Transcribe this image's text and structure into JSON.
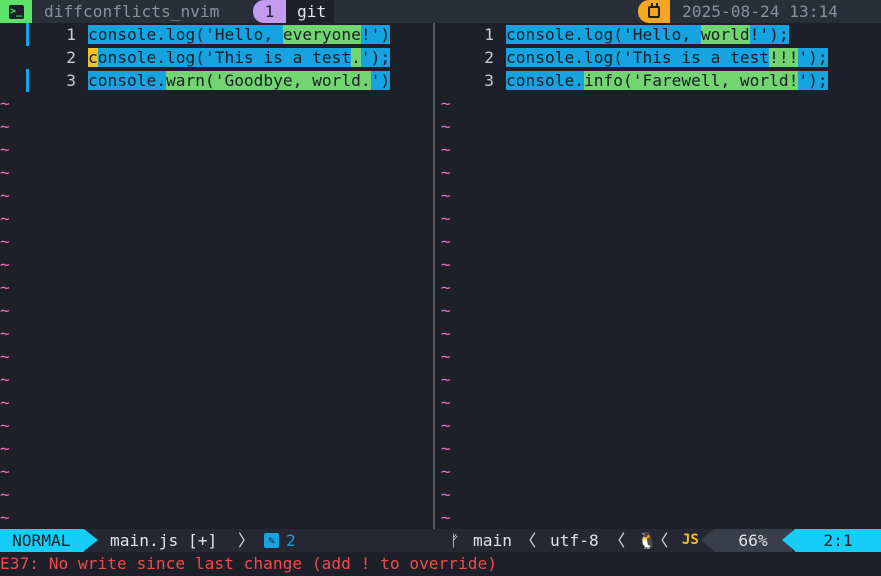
{
  "tmux": {
    "session_name": "diffconflicts_nvim",
    "window_index": "1",
    "window_name": "git",
    "datetime": "2025-08-24 13:14"
  },
  "left_pane": {
    "lines": [
      {
        "n": "1",
        "segments": [
          {
            "t": "console.log('Hello, ",
            "c": "chg"
          },
          {
            "t": "everyone",
            "c": "add"
          },
          {
            "t": "!')",
            "c": "chg"
          }
        ]
      },
      {
        "n": "2",
        "segments": [
          {
            "t": "c",
            "c": "cur"
          },
          {
            "t": "onsole.log('This is a test",
            "c": "chg"
          },
          {
            "t": ".",
            "c": "add"
          },
          {
            "t": "');",
            "c": "chg"
          }
        ]
      },
      {
        "n": "3",
        "segments": [
          {
            "t": "console.",
            "c": "chg"
          },
          {
            "t": "warn('Goodbye, world.",
            "c": "add"
          },
          {
            "t": "')",
            "c": "chg"
          }
        ]
      }
    ]
  },
  "right_pane": {
    "lines": [
      {
        "n": "1",
        "segments": [
          {
            "t": "console.log('Hello, ",
            "c": "chg"
          },
          {
            "t": "world",
            "c": "add"
          },
          {
            "t": "!');",
            "c": "chg"
          }
        ]
      },
      {
        "n": "2",
        "segments": [
          {
            "t": "console.log('This is a test",
            "c": "chg"
          },
          {
            "t": "!!!",
            "c": "add"
          },
          {
            "t": "');",
            "c": "chg"
          }
        ]
      },
      {
        "n": "3",
        "segments": [
          {
            "t": "console.",
            "c": "chg"
          },
          {
            "t": "info('Farewell, world!",
            "c": "add"
          },
          {
            "t": "');",
            "c": "chg"
          }
        ]
      }
    ]
  },
  "filler_char": "~",
  "statusline": {
    "mode": "NORMAL",
    "filename": "main.js [+]",
    "edit_count": "2",
    "branch": "main",
    "encoding": "utf-8",
    "filetype_icon": "JS",
    "percent": "66%",
    "position": "2:1"
  },
  "command_line": {
    "message": "E37: No write since last change (add ! to override)",
    "color": "#f24a4a"
  },
  "colors": {
    "diff_change": "#16a3df",
    "diff_text": "#72d571",
    "cursor": "#f0c21d",
    "mode_accent": "#16cdf7",
    "filler": "#f16ec7"
  }
}
